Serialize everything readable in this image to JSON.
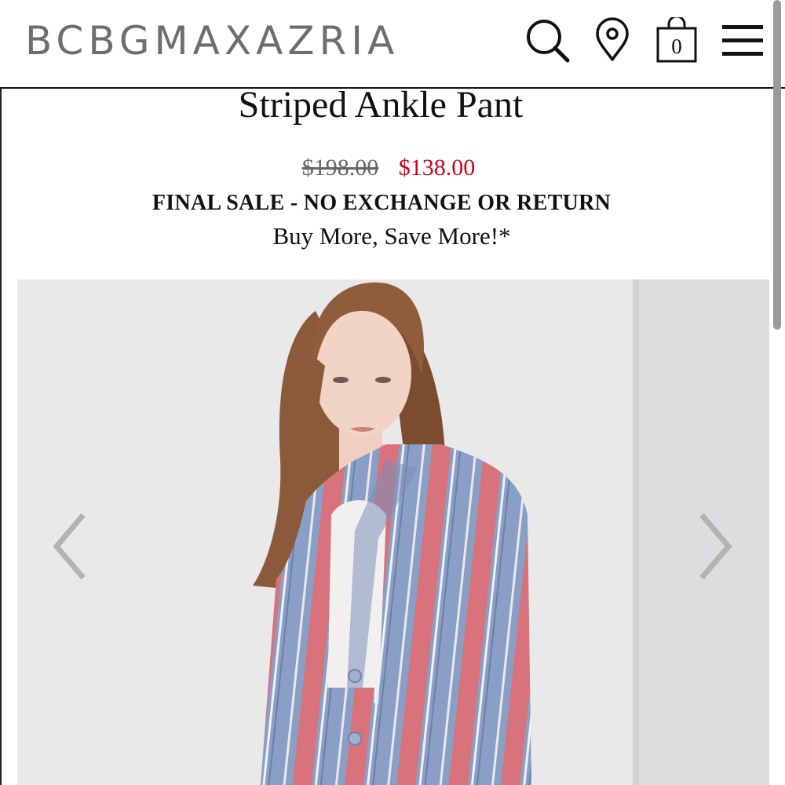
{
  "header": {
    "brand": "BCBGMAXAZRIA",
    "cart_count": "0",
    "icons": [
      "search-icon",
      "location-pin-icon",
      "shopping-bag-icon",
      "hamburger-menu-icon"
    ]
  },
  "product": {
    "title": "Striped Ankle Pant",
    "original_price": "$198.00",
    "sale_price": "$138.00",
    "final_sale_notice": "FINAL SALE - NO EXCHANGE OR RETURN",
    "promo_text": "Buy More, Save More!*"
  },
  "carousel": {
    "prev_icon": "chevron-left-icon",
    "next_icon": "chevron-right-icon"
  },
  "colors": {
    "brand_gray": "#6e6e6e",
    "sale_red": "#d0021b",
    "stripe_pink": "#d8727b",
    "stripe_blue": "#8a9fc5"
  }
}
